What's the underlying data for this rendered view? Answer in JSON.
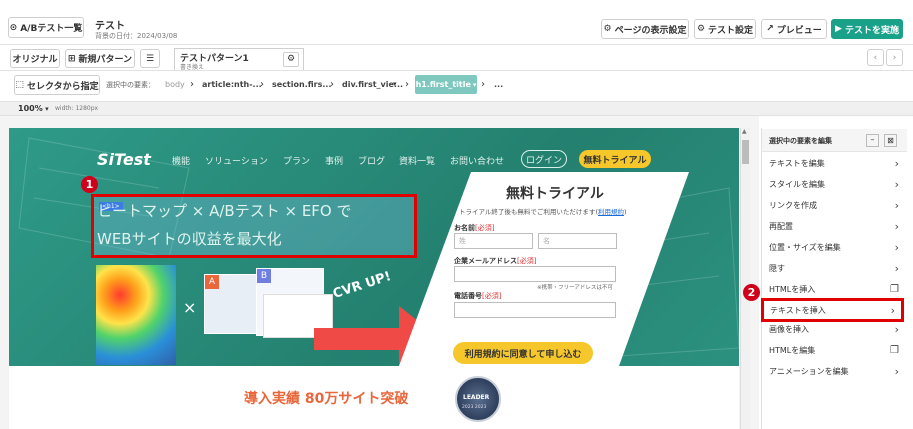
{
  "header": {
    "back_label": "A/Bテスト一覧",
    "title": "テスト",
    "subtitle": "背景の日付：2024/03/08",
    "page_display_settings": "ページの表示設定",
    "test_settings": "テスト設定",
    "preview": "プレビュー",
    "run_test": "テストを実施"
  },
  "tabs": {
    "original": "オリジナル",
    "new_pattern": "新規パターン",
    "pattern_name": "テストパターン1",
    "pattern_sub": "書き換え"
  },
  "selector": {
    "button": "セレクタから指定",
    "label": "選択中の要素：",
    "crumbs": [
      "body",
      "article:nth-...",
      "section.firs...",
      "div.first_vie...",
      "h1.first_title"
    ],
    "ellipsis": "..."
  },
  "zoom": {
    "level": "100%",
    "width_note": "width: 1280px"
  },
  "site": {
    "logo": "SiTest",
    "nav": [
      "機能",
      "ソリューション",
      "プラン",
      "事例",
      "ブログ",
      "資料一覧",
      "お問い合わせ"
    ],
    "login": "ログイン",
    "trial_button": "無料トライアル",
    "h1_tag": "<h1>",
    "headline_1": "ヒートマップ × A/Bテスト × EFO で",
    "headline_2": "WEBサイトの収益を最大化",
    "cvr": "CVR UP!",
    "times": "×",
    "achievement": "導入実績 80万サイト突破",
    "badge_text": "LEADER",
    "badge_year": "2023 2023"
  },
  "form": {
    "title": "無料トライアル",
    "note": "トライアル終了後も無料でご利用いただけます",
    "terms_link": "利用規約",
    "name_label": "お名前",
    "required": "[必須]",
    "last_name_placeholder": "姓",
    "first_name_placeholder": "名",
    "email_label": "企業メールアドレス",
    "email_note": "※携帯・フリーアドレスは不可",
    "phone_label": "電話番号",
    "submit": "利用規約に同意して申し込む"
  },
  "panel": {
    "title": "選択中の要素を編集",
    "items": [
      {
        "label": "テキストを編集",
        "icon": "chevron-right"
      },
      {
        "label": "スタイルを編集",
        "icon": "chevron-right"
      },
      {
        "label": "リンクを作成",
        "icon": "chevron-right"
      },
      {
        "label": "再配置",
        "icon": "chevron-right"
      },
      {
        "label": "位置・サイズを編集",
        "icon": "chevron-right"
      },
      {
        "label": "隠す",
        "icon": "chevron-right"
      },
      {
        "label": "HTMLを挿入",
        "icon": "copy"
      },
      {
        "label": "テキストを挿入",
        "icon": "chevron-right"
      },
      {
        "label": "画像を挿入",
        "icon": "chevron-right"
      },
      {
        "label": "HTMLを編集",
        "icon": "copy"
      },
      {
        "label": "アニメーションを編集",
        "icon": "chevron-right"
      }
    ]
  },
  "annotations": {
    "marker_1": "1",
    "marker_2": "2"
  },
  "colors": {
    "teal": "#1aa18a",
    "hero_bg": "#2a8f7f",
    "highlight_red": "#e00000",
    "yellow": "#f6c72a",
    "achievement_orange": "#e9673a",
    "selected_crumb": "#7ec8c0"
  }
}
